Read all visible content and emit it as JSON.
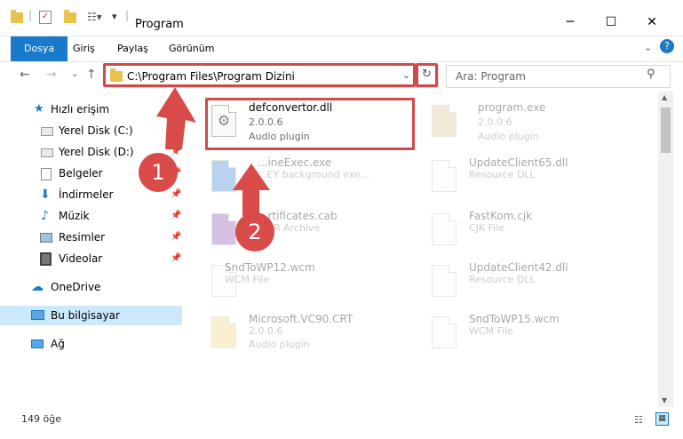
{
  "window": {
    "title": "Program"
  },
  "ribbon": {
    "tabs": [
      "Dosya",
      "Giriş",
      "Paylaş",
      "Görünüm"
    ]
  },
  "address": {
    "path": "C:\\Program Files\\Program Dizini"
  },
  "search": {
    "placeholder": "Ara: Program"
  },
  "sidebar": {
    "items": [
      {
        "label": "Hızlı erişim"
      },
      {
        "label": "Yerel Disk (C:)"
      },
      {
        "label": "Yerel Disk (D:)"
      },
      {
        "label": "Belgeler"
      },
      {
        "label": "İndirmeler"
      },
      {
        "label": "Müzik"
      },
      {
        "label": "Resimler"
      },
      {
        "label": "Videolar"
      },
      {
        "label": "OneDrive"
      },
      {
        "label": "Bu bilgisayar"
      },
      {
        "label": "Ağ"
      }
    ]
  },
  "files": [
    {
      "name": "defconvertor.dll",
      "version": "2.0.0.6",
      "type": "Audio plugin"
    },
    {
      "name": "program.exe",
      "version": "2.0.0.6",
      "type": "Audio plugin"
    },
    {
      "name": "...ineExec.exe",
      "type": "...EY background exe..."
    },
    {
      "name": "UpdateClient65.dll",
      "type": "Resource DLL"
    },
    {
      "name": "...rtificates.cab",
      "type": "...AR Archive"
    },
    {
      "name": "FastKom.cjk",
      "type": "CJK File"
    },
    {
      "name": "SndToWP12.wcm",
      "type": "WCM File"
    },
    {
      "name": "UpdateClient42.dll",
      "type": "Resource DLL"
    },
    {
      "name": "Microsoft.VC90.CRT",
      "version": "2.0.0.6",
      "type": "Audio plugin"
    },
    {
      "name": "SndToWP15.wcm",
      "type": "WCM File"
    }
  ],
  "annotations": {
    "step1": "1",
    "step2": "2"
  },
  "status": {
    "count": "149 öğe"
  },
  "colors": {
    "accent": "#1979ca",
    "highlight": "#d04a4a",
    "badge": "#d94b48",
    "selected": "#cce8ff"
  }
}
